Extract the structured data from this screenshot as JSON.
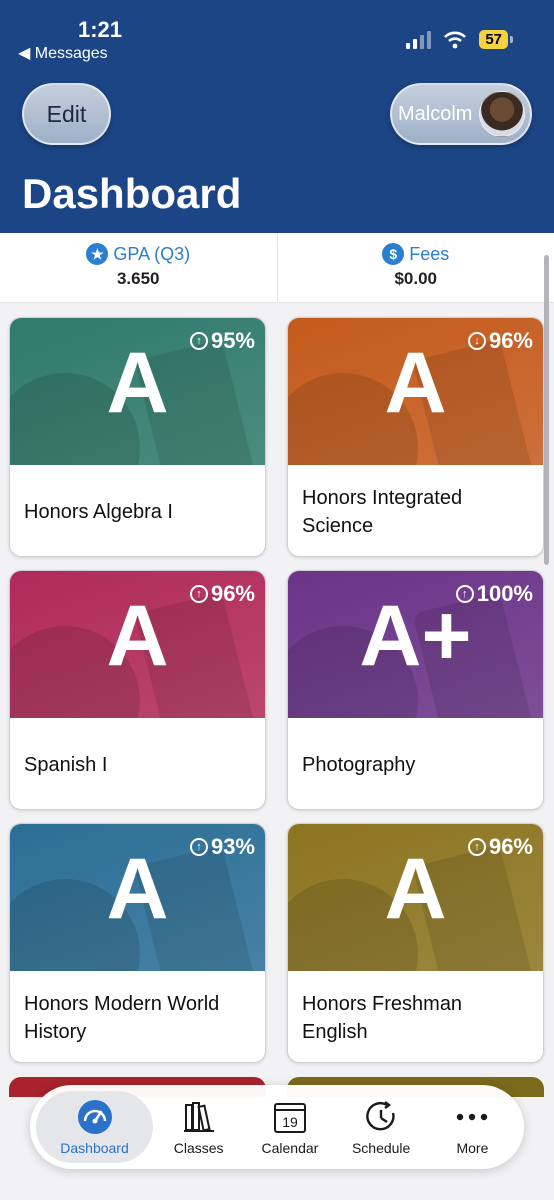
{
  "status_bar": {
    "time": "1:21",
    "back_label": "◀ Messages",
    "battery": "57"
  },
  "header": {
    "edit_label": "Edit",
    "user_name": "Malcolm",
    "title": "Dashboard"
  },
  "summary": {
    "gpa": {
      "label": "GPA (Q3)",
      "value": "3.650",
      "icon": "star-icon"
    },
    "fees": {
      "label": "Fees",
      "value": "$0.00",
      "icon": "dollar-icon"
    }
  },
  "classes": [
    {
      "name": "Honors Algebra I",
      "grade": "A",
      "percent": "95%",
      "trend": "up",
      "color": "#2f7a6b"
    },
    {
      "name": "Honors Integrated Science",
      "grade": "A",
      "percent": "96%",
      "trend": "down",
      "color": "#c45a1c"
    },
    {
      "name": "Spanish I",
      "grade": "A",
      "percent": "96%",
      "trend": "up",
      "color": "#b02a58"
    },
    {
      "name": "Photography",
      "grade": "A+",
      "percent": "100%",
      "trend": "up",
      "color": "#6a3388"
    },
    {
      "name": "Honors Modern World History",
      "grade": "A",
      "percent": "93%",
      "trend": "up",
      "color": "#2b6e96"
    },
    {
      "name": "Honors Freshman English",
      "grade": "A",
      "percent": "96%",
      "trend": "up",
      "color": "#8c7420"
    }
  ],
  "peek_colors": [
    "#a8232b",
    "#7a6a1c"
  ],
  "tabs": [
    {
      "label": "Dashboard",
      "icon": "gauge-icon",
      "active": true
    },
    {
      "label": "Classes",
      "icon": "books-icon",
      "active": false
    },
    {
      "label": "Calendar",
      "icon": "calendar-icon",
      "active": false,
      "day": "19"
    },
    {
      "label": "Schedule",
      "icon": "clock-icon",
      "active": false
    },
    {
      "label": "More",
      "icon": "ellipsis-icon",
      "active": false
    }
  ]
}
